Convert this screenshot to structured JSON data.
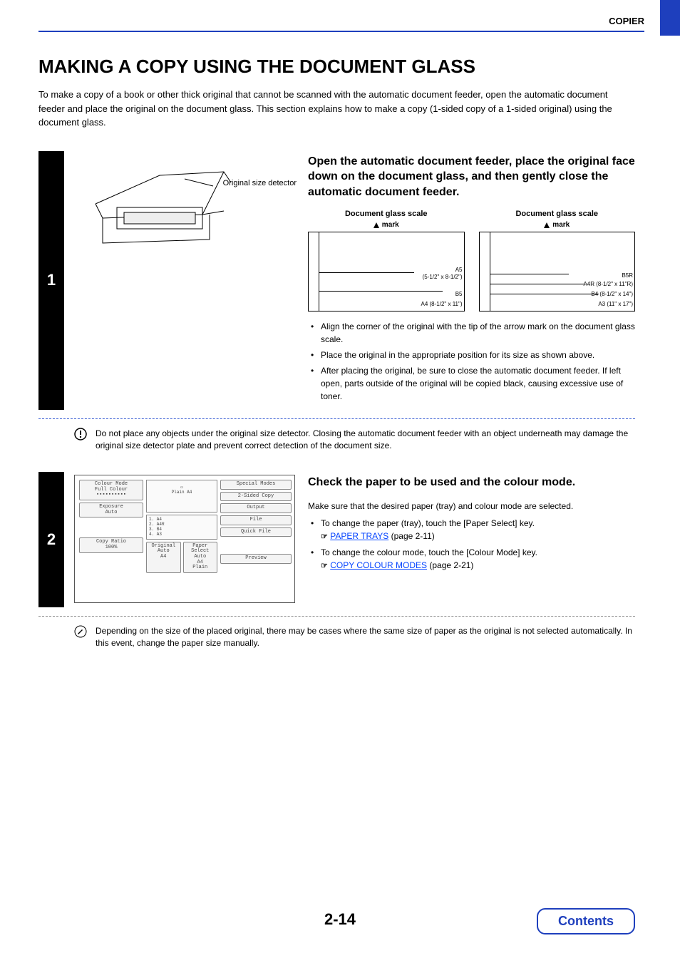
{
  "header": {
    "section": "COPIER"
  },
  "title": "MAKING A COPY USING THE DOCUMENT GLASS",
  "intro": "To make a copy of a book or other thick original that cannot be scanned with the automatic document feeder, open the automatic document feeder and place the original on the document glass. This section explains how to make a copy (1-sided copy of a 1-sided original) using the document glass.",
  "step1": {
    "number": "1",
    "figure_label": "Original size detector",
    "heading": "Open the automatic document feeder, place the original face down on the document glass, and then gently close the automatic document feeder.",
    "scale_title_a": "Document glass scale",
    "scale_title_b": "Document glass scale",
    "mark_label": "mark",
    "scale_a": {
      "l1": "A5",
      "l2": "(5-1/2\" x 8-1/2\")",
      "l3": "B5",
      "l4": "A4 (8-1/2\" x 11\")"
    },
    "scale_b": {
      "l1": "B5R",
      "l2": "A4R (8-1/2\" x 11\"R)",
      "l3": "B4 (8-1/2\" x 14\")",
      "l4": "A3 (11\" x 17\")"
    },
    "bullets": [
      "Align the corner of the original with the tip of the arrow mark      on the document glass scale.",
      "Place the original in the appropriate position for its size as shown above.",
      "After placing the original, be sure to close the automatic document feeder. If left open, parts outside of the original will be copied black, causing excessive use of toner."
    ],
    "caution": "Do not place any objects under the original size detector. Closing the automatic document feeder with an object underneath may damage the original size detector plate and prevent correct detection of the document size."
  },
  "step2": {
    "number": "2",
    "heading": "Check the paper to be used and the colour mode.",
    "desc": "Make sure that the desired paper (tray) and colour mode are selected.",
    "sub1_text": "To change the paper (tray), touch the [Paper Select] key.",
    "sub1_link": "PAPER TRAYS",
    "sub1_page": "(page 2-11)",
    "sub2_text": "To change the colour mode, touch the [Colour Mode] key.",
    "sub2_link": "COPY COLOUR MODES",
    "sub2_page": "(page 2-21)",
    "note": "Depending on the size of the placed original, there may be cases where the same size of paper as the original is not selected automatically. In this event, change the paper size manually.",
    "panel": {
      "colour_mode_label": "Colour Mode",
      "colour_mode_value": "Full Colour",
      "exposure_label": "Exposure",
      "exposure_value": "Auto",
      "copy_ratio_label": "Copy Ratio",
      "copy_ratio_value": "100%",
      "original_label": "Original",
      "original_value": "Auto",
      "original_size": "A4",
      "paper_select_label": "Paper Select",
      "paper_select_value1": "Auto",
      "paper_select_value2": "A4",
      "paper_select_value3": "Plain",
      "tray_plain": "Plain",
      "tray_a4": "A4",
      "trays": [
        "1. A4",
        "2. A4R",
        "3. B4",
        "4. A3"
      ],
      "buttons": {
        "special": "Special Modes",
        "twosided": "2-Sided Copy",
        "output": "Output",
        "file": "File",
        "quickfile": "Quick File",
        "preview": "Preview"
      }
    }
  },
  "pagenum": "2-14",
  "contents_btn": "Contents"
}
